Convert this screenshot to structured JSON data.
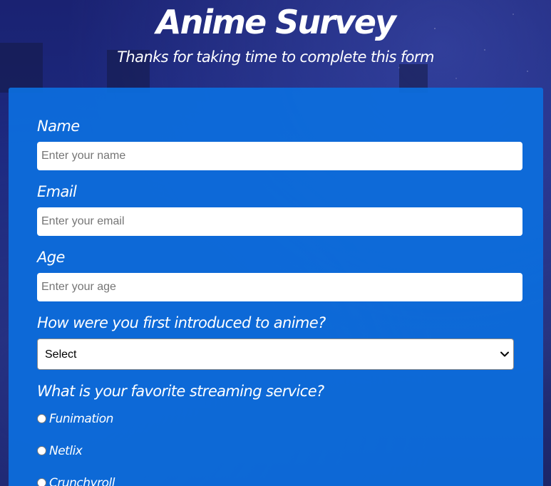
{
  "header": {
    "title": "Anime Survey",
    "subtitle": "Thanks for taking time to complete this form"
  },
  "form": {
    "name": {
      "label": "Name",
      "placeholder": "Enter your name",
      "value": ""
    },
    "email": {
      "label": "Email",
      "placeholder": "Enter your email",
      "value": ""
    },
    "age": {
      "label": "Age",
      "placeholder": "Enter your age",
      "value": ""
    },
    "introduced": {
      "label": "How were you first introduced to anime?",
      "selected": "Select"
    },
    "streaming": {
      "label": "What is your favorite streaming service?",
      "options": [
        {
          "label": "Funimation",
          "checked": false
        },
        {
          "label": "Netlix",
          "checked": false
        },
        {
          "label": "Crunchyroll",
          "checked": false
        }
      ]
    }
  },
  "colors": {
    "card": "#0c6ede",
    "background": "#1d2a80",
    "text": "#ffffff"
  }
}
